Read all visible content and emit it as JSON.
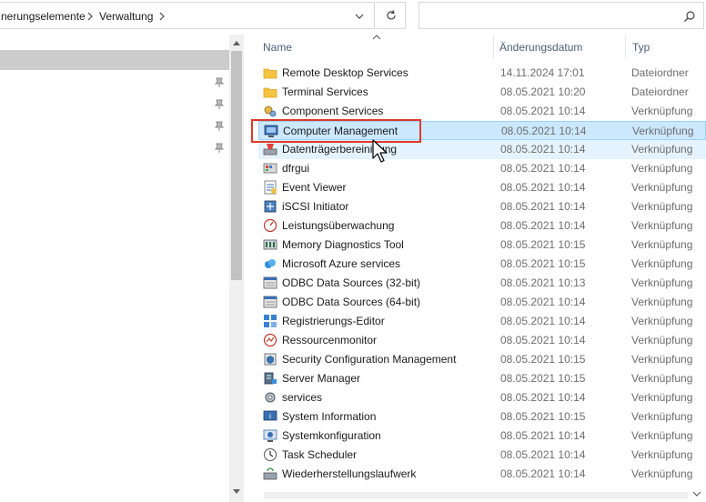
{
  "address": {
    "breadcrumb": [
      "nerungselemente",
      "Verwaltung"
    ],
    "search_placeholder": ""
  },
  "columns": {
    "name": "Name",
    "date": "Änderungsdatum",
    "type": "Typ"
  },
  "colors": {
    "selection_bg": "#cce8ff",
    "selection_border": "#99d1ff",
    "hover_bg": "#e5f3ff",
    "highlight_box": "#e0392b",
    "header_text": "#4c607a"
  },
  "files": [
    {
      "name": "Remote Desktop Services",
      "date": "14.11.2024 17:01",
      "type": "Dateiordner",
      "icon": "folder-icon"
    },
    {
      "name": "Terminal Services",
      "date": "08.05.2021 10:20",
      "type": "Dateiordner",
      "icon": "folder-icon"
    },
    {
      "name": "Component Services",
      "date": "08.05.2021 10:14",
      "type": "Verknüpfung",
      "icon": "component-services-icon"
    },
    {
      "name": "Computer Management",
      "date": "08.05.2021 10:14",
      "type": "Verknüpfung",
      "icon": "computer-management-icon",
      "state": "selected"
    },
    {
      "name": "Datenträgerbereinigung",
      "date": "08.05.2021 10:14",
      "type": "Verknüpfung",
      "icon": "disk-cleanup-icon",
      "state": "hovered"
    },
    {
      "name": "dfrgui",
      "date": "08.05.2021 10:14",
      "type": "Verknüpfung",
      "icon": "defrag-icon"
    },
    {
      "name": "Event Viewer",
      "date": "08.05.2021 10:14",
      "type": "Verknüpfung",
      "icon": "event-viewer-icon"
    },
    {
      "name": "iSCSI Initiator",
      "date": "08.05.2021 10:14",
      "type": "Verknüpfung",
      "icon": "iscsi-icon"
    },
    {
      "name": "Leistungsüberwachung",
      "date": "08.05.2021 10:14",
      "type": "Verknüpfung",
      "icon": "performance-monitor-icon"
    },
    {
      "name": "Memory Diagnostics Tool",
      "date": "08.05.2021 10:15",
      "type": "Verknüpfung",
      "icon": "memory-diagnostics-icon"
    },
    {
      "name": "Microsoft Azure services",
      "date": "08.05.2021 10:15",
      "type": "Verknüpfung",
      "icon": "azure-icon"
    },
    {
      "name": "ODBC Data Sources (32-bit)",
      "date": "08.05.2021 10:13",
      "type": "Verknüpfung",
      "icon": "odbc-icon"
    },
    {
      "name": "ODBC Data Sources (64-bit)",
      "date": "08.05.2021 10:14",
      "type": "Verknüpfung",
      "icon": "odbc-icon"
    },
    {
      "name": "Registrierungs-Editor",
      "date": "08.05.2021 10:14",
      "type": "Verknüpfung",
      "icon": "registry-editor-icon"
    },
    {
      "name": "Ressourcenmonitor",
      "date": "08.05.2021 10:14",
      "type": "Verknüpfung",
      "icon": "resource-monitor-icon"
    },
    {
      "name": "Security Configuration Management",
      "date": "08.05.2021 10:15",
      "type": "Verknüpfung",
      "icon": "security-config-icon"
    },
    {
      "name": "Server Manager",
      "date": "08.05.2021 10:15",
      "type": "Verknüpfung",
      "icon": "server-manager-icon"
    },
    {
      "name": "services",
      "date": "08.05.2021 10:14",
      "type": "Verknüpfung",
      "icon": "services-icon"
    },
    {
      "name": "System Information",
      "date": "08.05.2021 10:15",
      "type": "Verknüpfung",
      "icon": "system-information-icon"
    },
    {
      "name": "Systemkonfiguration",
      "date": "08.05.2021 10:14",
      "type": "Verknüpfung",
      "icon": "system-configuration-icon"
    },
    {
      "name": "Task Scheduler",
      "date": "08.05.2021 10:14",
      "type": "Verknüpfung",
      "icon": "task-scheduler-icon"
    },
    {
      "name": "Wiederherstellungslaufwerk",
      "date": "08.05.2021 10:14",
      "type": "Verknüpfung",
      "icon": "recovery-drive-icon"
    }
  ]
}
